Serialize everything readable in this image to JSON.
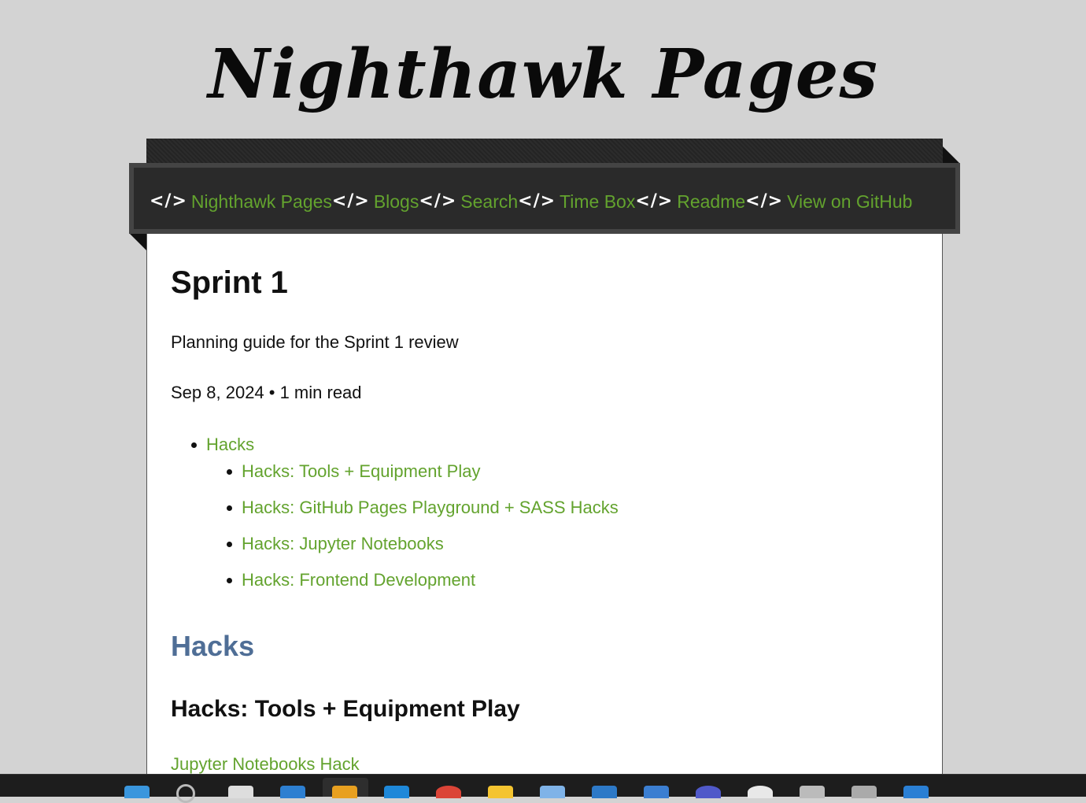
{
  "site": {
    "title": "Nighthawk Pages"
  },
  "nav": {
    "icon_glyph": "</>",
    "items": [
      {
        "label": "Nighthawk Pages"
      },
      {
        "label": "Blogs"
      },
      {
        "label": "Search"
      },
      {
        "label": "Time Box"
      },
      {
        "label": "Readme"
      },
      {
        "label": "View on GitHub"
      }
    ]
  },
  "post": {
    "title": "Sprint 1",
    "description": "Planning guide for the Sprint 1 review",
    "meta": "Sep 8, 2024 • 1 min read",
    "toc": {
      "top": "Hacks",
      "sub": [
        "Hacks: Tools + Equipment Play",
        "Hacks: GitHub Pages Playground + SASS Hacks",
        "Hacks: Jupyter Notebooks",
        "Hacks: Frontend Development"
      ]
    },
    "section_heading": "Hacks",
    "subsection_heading": "Hacks: Tools + Equipment Play",
    "first_link": "Jupyter Notebooks Hack"
  },
  "taskbar": {
    "icons": [
      "windows-start-icon",
      "search-icon",
      "file-icon",
      "edge-icon",
      "app-icon",
      "store-icon",
      "chrome-icon",
      "folder-icon",
      "notepad-icon",
      "vscode-icon",
      "mail-icon",
      "teams-icon",
      "slack-icon",
      "terminal-icon",
      "explorer-icon",
      "todo-icon"
    ],
    "colors": [
      "#3a96dd",
      "#bbbbbb",
      "#dddddd",
      "#2d7fd1",
      "#e8a020",
      "#1e88d9",
      "#db4437",
      "#f4c430",
      "#7fb3e8",
      "#2d79c7",
      "#3b7ed1",
      "#5059c9",
      "#e8e8e8",
      "#bbbbbb",
      "#aaaaaa",
      "#2a7fd4"
    ]
  },
  "colors": {
    "background": "#d3d3d3",
    "link": "#63a32e",
    "section_heading": "#4f6e96",
    "nav_bar": "#2a2a2a"
  }
}
